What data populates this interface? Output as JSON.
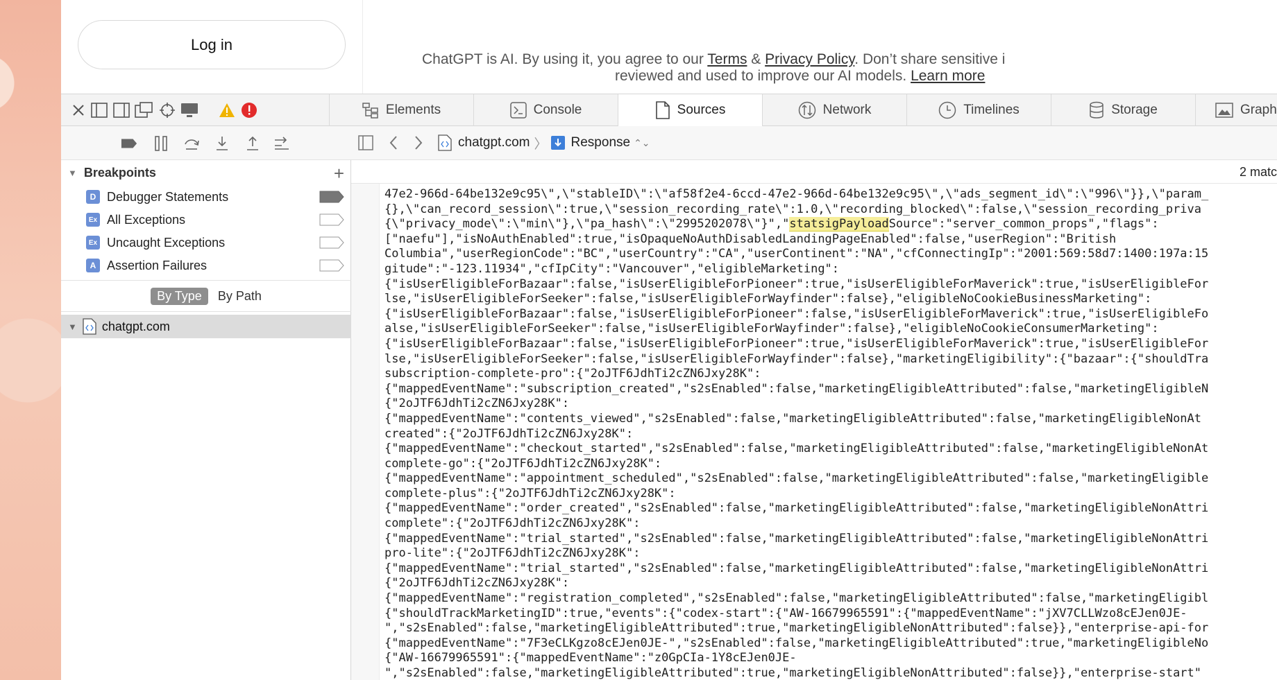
{
  "webpage": {
    "login_label": "Log in",
    "disclaimer_pre": "ChatGPT is AI. By using it, you agree to our ",
    "terms_link": "Terms",
    "amp": " & ",
    "privacy_link": "Privacy Policy",
    "disclaimer_post": ". Don’t share sensitive i",
    "disclaimer_line2": "reviewed and used to improve our AI models. ",
    "learn_more": "Learn more"
  },
  "devtools": {
    "tabs": [
      {
        "label": "Elements",
        "icon": "elements-icon"
      },
      {
        "label": "Console",
        "icon": "console-icon"
      },
      {
        "label": "Sources",
        "icon": "sources-icon",
        "active": true
      },
      {
        "label": "Network",
        "icon": "network-icon"
      },
      {
        "label": "Timelines",
        "icon": "timelines-icon"
      },
      {
        "label": "Storage",
        "icon": "storage-icon"
      },
      {
        "label": "Graph",
        "icon": "graphics-icon"
      }
    ]
  },
  "sidebar": {
    "breakpoints_title": "Breakpoints",
    "breakpoints": [
      {
        "badge": "D",
        "label": "Debugger Statements",
        "color": "#6b8fd6"
      },
      {
        "badge": "Ex",
        "label": "All Exceptions",
        "color": "#6b8fd6"
      },
      {
        "badge": "Ex",
        "label": "Uncaught Exceptions",
        "color": "#6b8fd6"
      },
      {
        "badge": "A",
        "label": "Assertion Failures",
        "color": "#6b8fd6"
      }
    ],
    "by_type": "By Type",
    "by_path": "By Path",
    "source": "chatgpt.com"
  },
  "content": {
    "breadcrumb_domain": "chatgpt.com",
    "breadcrumb_resource": "Response",
    "match_count": "2 matc",
    "highlight": "statsigPayload",
    "code_lines": [
      "47e2-966d-64be132e9c95\\\",\\\"stableID\\\":\\\"af58f2e4-6ccd-47e2-966d-64be132e9c95\\\",\\\"ads_segment_id\\\":\\\"996\\\"}},\\\"param_",
      "{},\\\"can_record_session\\\":true,\\\"session_recording_rate\\\":1.0,\\\"recording_blocked\\\":false,\\\"session_recording_priva",
      "{\\\"privacy_mode\\\":\\\"min\\\"},\\\"pa_hash\\\":\\\"2995202078\\\"}\",\"statsigPayloadSource\":\"server_common_props\",\"flags\":",
      "[\"naefu\"],\"isNoAuthEnabled\":true,\"isOpaqueNoAuthDisabledLandingPageEnabled\":false,\"userRegion\":\"British",
      "Columbia\",\"userRegionCode\":\"BC\",\"userCountry\":\"CA\",\"userContinent\":\"NA\",\"cfConnectingIp\":\"2001:569:58d7:1400:197a:15",
      "gitude\":\"-123.11934\",\"cfIpCity\":\"Vancouver\",\"eligibleMarketing\":",
      "{\"isUserEligibleForBazaar\":false,\"isUserEligibleForPioneer\":true,\"isUserEligibleForMaverick\":true,\"isUserEligibleFor",
      "lse,\"isUserEligibleForSeeker\":false,\"isUserEligibleForWayfinder\":false},\"eligibleNoCookieBusinessMarketing\":",
      "{\"isUserEligibleForBazaar\":false,\"isUserEligibleForPioneer\":false,\"isUserEligibleForMaverick\":true,\"isUserEligibleFo",
      "alse,\"isUserEligibleForSeeker\":false,\"isUserEligibleForWayfinder\":false},\"eligibleNoCookieConsumerMarketing\":",
      "{\"isUserEligibleForBazaar\":false,\"isUserEligibleForPioneer\":true,\"isUserEligibleForMaverick\":true,\"isUserEligibleFor",
      "lse,\"isUserEligibleForSeeker\":false,\"isUserEligibleForWayfinder\":false},\"marketingEligibility\":{\"bazaar\":{\"shouldTra",
      "subscription-complete-pro\":{\"2oJTF6JdhTi2cZN6Jxy28K\":",
      "{\"mappedEventName\":\"subscription_created\",\"s2sEnabled\":false,\"marketingEligibleAttributed\":false,\"marketingEligibleN",
      "{\"2oJTF6JdhTi2cZN6Jxy28K\":",
      "{\"mappedEventName\":\"contents_viewed\",\"s2sEnabled\":false,\"marketingEligibleAttributed\":false,\"marketingEligibleNonAt",
      "created\":{\"2oJTF6JdhTi2cZN6Jxy28K\":",
      "{\"mappedEventName\":\"checkout_started\",\"s2sEnabled\":false,\"marketingEligibleAttributed\":false,\"marketingEligibleNonAt",
      "complete-go\":{\"2oJTF6JdhTi2cZN6Jxy28K\":",
      "{\"mappedEventName\":\"appointment_scheduled\",\"s2sEnabled\":false,\"marketingEligibleAttributed\":false,\"marketingEligible",
      "complete-plus\":{\"2oJTF6JdhTi2cZN6Jxy28K\":",
      "{\"mappedEventName\":\"order_created\",\"s2sEnabled\":false,\"marketingEligibleAttributed\":false,\"marketingEligibleNonAttri",
      "complete\":{\"2oJTF6JdhTi2cZN6Jxy28K\":",
      "{\"mappedEventName\":\"trial_started\",\"s2sEnabled\":false,\"marketingEligibleAttributed\":false,\"marketingEligibleNonAttri",
      "pro-lite\":{\"2oJTF6JdhTi2cZN6Jxy28K\":",
      "{\"mappedEventName\":\"trial_started\",\"s2sEnabled\":false,\"marketingEligibleAttributed\":false,\"marketingEligibleNonAttri",
      "{\"2oJTF6JdhTi2cZN6Jxy28K\":",
      "{\"mappedEventName\":\"registration_completed\",\"s2sEnabled\":false,\"marketingEligibleAttributed\":false,\"marketingEligibl",
      "{\"shouldTrackMarketingID\":true,\"events\":{\"codex-start\":{\"AW-16679965591\":{\"mappedEventName\":\"jXV7CLLWzo8cEJen0JE-",
      "\",\"s2sEnabled\":false,\"marketingEligibleAttributed\":true,\"marketingEligibleNonAttributed\":false}},\"enterprise-api-for",
      "{\"mappedEventName\":\"7F3eCLKgzo8cEJen0JE-\",\"s2sEnabled\":false,\"marketingEligibleAttributed\":true,\"marketingEligibleNo",
      "{\"AW-16679965591\":{\"mappedEventName\":\"z0GpCIa-1Y8cEJen0JE-",
      "\",\"s2sEnabled\":false,\"marketingEligibleAttributed\":true,\"marketingEligibleNonAttributed\":false}},\"enterprise-start\""
    ]
  }
}
